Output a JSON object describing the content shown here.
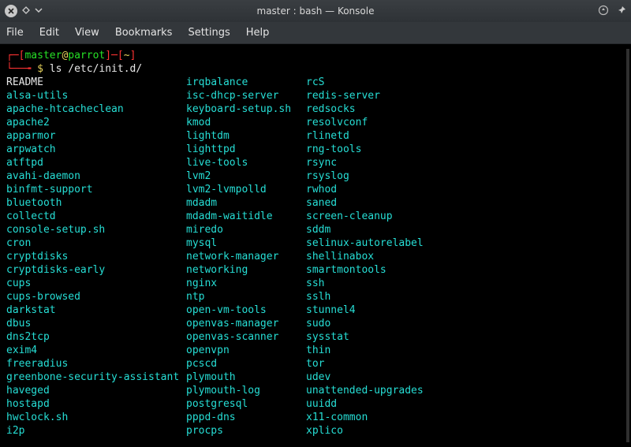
{
  "window": {
    "title": "master : bash — Konsole"
  },
  "menu": {
    "items": [
      "File",
      "Edit",
      "View",
      "Bookmarks",
      "Settings",
      "Help"
    ]
  },
  "prompt": {
    "open": "┌─[",
    "user": "master",
    "at": "@",
    "host": "parrot",
    "mid": "]─[",
    "cwd": "~",
    "close": "]",
    "line2_open": "└──╼ ",
    "dollar": "$",
    "command": "ls /etc/init.d/"
  },
  "listing": {
    "rows": [
      {
        "cells": [
          "README",
          "irqbalance",
          "rcS"
        ],
        "classes": [
          "p-white",
          "p-teal",
          "p-teal"
        ]
      },
      {
        "cells": [
          "alsa-utils",
          "isc-dhcp-server",
          "redis-server"
        ],
        "classes": [
          "p-teal",
          "p-teal",
          "p-teal"
        ]
      },
      {
        "cells": [
          "apache-htcacheclean",
          "keyboard-setup.sh",
          "redsocks"
        ],
        "classes": [
          "p-teal",
          "p-teal",
          "p-teal"
        ]
      },
      {
        "cells": [
          "apache2",
          "kmod",
          "resolvconf"
        ],
        "classes": [
          "p-teal",
          "p-teal",
          "p-teal"
        ]
      },
      {
        "cells": [
          "apparmor",
          "lightdm",
          "rlinetd"
        ],
        "classes": [
          "p-teal",
          "p-teal",
          "p-teal"
        ]
      },
      {
        "cells": [
          "arpwatch",
          "lighttpd",
          "rng-tools"
        ],
        "classes": [
          "p-teal",
          "p-teal",
          "p-teal"
        ]
      },
      {
        "cells": [
          "atftpd",
          "live-tools",
          "rsync"
        ],
        "classes": [
          "p-teal",
          "p-teal",
          "p-teal"
        ]
      },
      {
        "cells": [
          "avahi-daemon",
          "lvm2",
          "rsyslog"
        ],
        "classes": [
          "p-teal",
          "p-teal",
          "p-teal"
        ]
      },
      {
        "cells": [
          "binfmt-support",
          "lvm2-lvmpolld",
          "rwhod"
        ],
        "classes": [
          "p-teal",
          "p-teal",
          "p-teal"
        ]
      },
      {
        "cells": [
          "bluetooth",
          "mdadm",
          "saned"
        ],
        "classes": [
          "p-teal",
          "p-teal",
          "p-teal"
        ]
      },
      {
        "cells": [
          "collectd",
          "mdadm-waitidle",
          "screen-cleanup"
        ],
        "classes": [
          "p-teal",
          "p-teal",
          "p-teal"
        ]
      },
      {
        "cells": [
          "console-setup.sh",
          "miredo",
          "sddm"
        ],
        "classes": [
          "p-teal",
          "p-teal",
          "p-teal"
        ]
      },
      {
        "cells": [
          "cron",
          "mysql",
          "selinux-autorelabel"
        ],
        "classes": [
          "p-teal",
          "p-teal",
          "p-teal"
        ]
      },
      {
        "cells": [
          "cryptdisks",
          "network-manager",
          "shellinabox"
        ],
        "classes": [
          "p-teal",
          "p-teal",
          "p-teal"
        ]
      },
      {
        "cells": [
          "cryptdisks-early",
          "networking",
          "smartmontools"
        ],
        "classes": [
          "p-teal",
          "p-teal",
          "p-teal"
        ]
      },
      {
        "cells": [
          "cups",
          "nginx",
          "ssh"
        ],
        "classes": [
          "p-teal",
          "p-teal",
          "p-teal"
        ]
      },
      {
        "cells": [
          "cups-browsed",
          "ntp",
          "sslh"
        ],
        "classes": [
          "p-teal",
          "p-teal",
          "p-teal"
        ]
      },
      {
        "cells": [
          "darkstat",
          "open-vm-tools",
          "stunnel4"
        ],
        "classes": [
          "p-teal",
          "p-teal",
          "p-teal"
        ]
      },
      {
        "cells": [
          "dbus",
          "openvas-manager",
          "sudo"
        ],
        "classes": [
          "p-teal",
          "p-teal",
          "p-teal"
        ]
      },
      {
        "cells": [
          "dns2tcp",
          "openvas-scanner",
          "sysstat"
        ],
        "classes": [
          "p-teal",
          "p-teal",
          "p-teal"
        ]
      },
      {
        "cells": [
          "exim4",
          "openvpn",
          "thin"
        ],
        "classes": [
          "p-teal",
          "p-teal",
          "p-teal"
        ]
      },
      {
        "cells": [
          "freeradius",
          "pcscd",
          "tor"
        ],
        "classes": [
          "p-teal",
          "p-teal",
          "p-teal"
        ]
      },
      {
        "cells": [
          "greenbone-security-assistant",
          "plymouth",
          "udev"
        ],
        "classes": [
          "p-teal",
          "p-teal",
          "p-teal"
        ]
      },
      {
        "cells": [
          "haveged",
          "plymouth-log",
          "unattended-upgrades"
        ],
        "classes": [
          "p-teal",
          "p-teal",
          "p-teal"
        ]
      },
      {
        "cells": [
          "hostapd",
          "postgresql",
          "uuidd"
        ],
        "classes": [
          "p-teal",
          "p-teal",
          "p-teal"
        ]
      },
      {
        "cells": [
          "hwclock.sh",
          "pppd-dns",
          "x11-common"
        ],
        "classes": [
          "p-teal",
          "p-teal",
          "p-teal"
        ]
      },
      {
        "cells": [
          "i2p",
          "procps",
          "xplico"
        ],
        "classes": [
          "p-teal",
          "p-teal",
          "p-teal"
        ]
      }
    ]
  }
}
